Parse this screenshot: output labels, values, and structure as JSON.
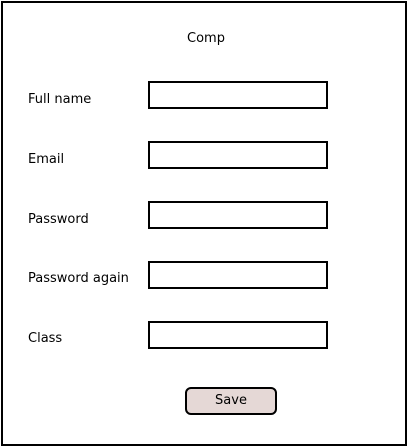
{
  "form": {
    "title": "Comp",
    "fields": [
      {
        "label": "Full name",
        "value": ""
      },
      {
        "label": "Email",
        "value": ""
      },
      {
        "label": "Password",
        "value": ""
      },
      {
        "label": "Password again",
        "value": ""
      },
      {
        "label": "Class",
        "value": ""
      }
    ],
    "save_label": "Save"
  },
  "colors": {
    "background": "#ffffff",
    "border": "#000000",
    "button_fill": "#e5d8d6"
  }
}
